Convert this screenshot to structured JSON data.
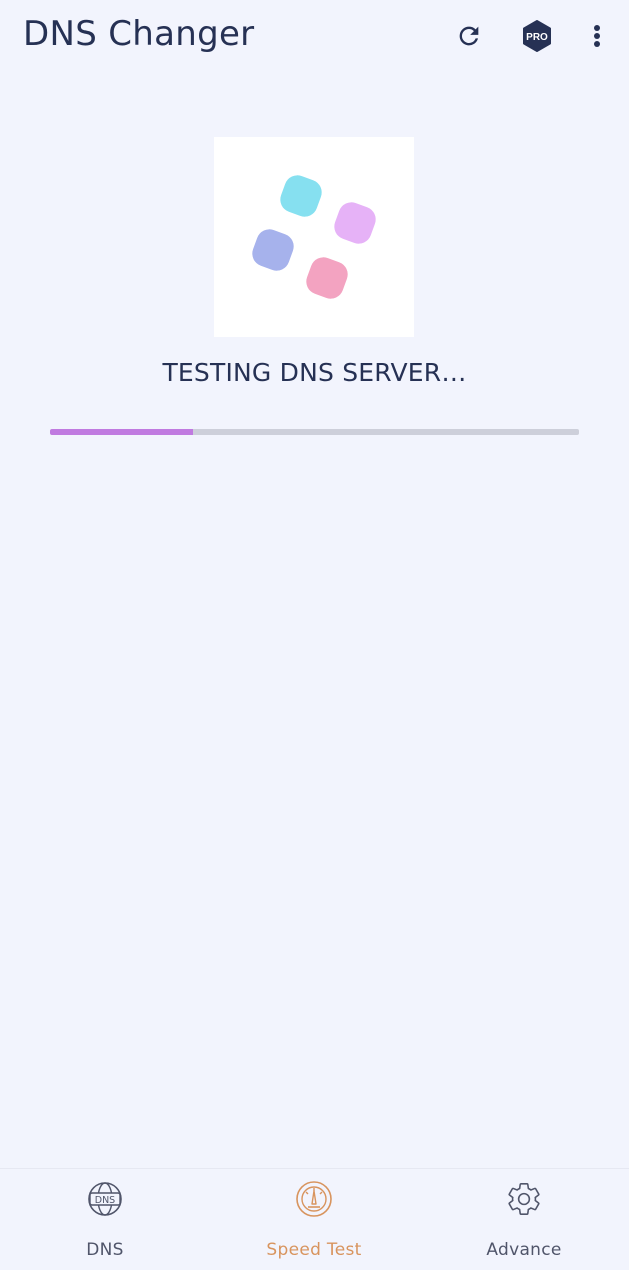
{
  "app_bar": {
    "title": "DNS Changer",
    "actions": [
      {
        "name": "refresh-icon"
      },
      {
        "name": "pro-badge-icon",
        "label": "PRO"
      },
      {
        "name": "more-vert-icon"
      }
    ]
  },
  "loader": {
    "dots": [
      {
        "name": "cyan-dot",
        "color": "#86e0f0"
      },
      {
        "name": "violet-dot",
        "color": "#e6b2f7"
      },
      {
        "name": "blue-dot",
        "color": "#a6b2ec"
      },
      {
        "name": "pink-dot",
        "color": "#f3a3c1"
      }
    ]
  },
  "status": {
    "text": "TESTING DNS SERVER…",
    "progress": 0.27
  },
  "bottom_nav": {
    "items": [
      {
        "label": "DNS",
        "icon": "dns-globe-icon",
        "active": false
      },
      {
        "label": "Speed Test",
        "icon": "speedometer-icon",
        "active": true
      },
      {
        "label": "Advance",
        "icon": "gear-icon",
        "active": false
      }
    ]
  },
  "colors": {
    "background": "#f2f4fd",
    "text": "#263154",
    "accent": "#d8945e",
    "progress": "#c07ae0",
    "pro_badge": "#263154"
  }
}
